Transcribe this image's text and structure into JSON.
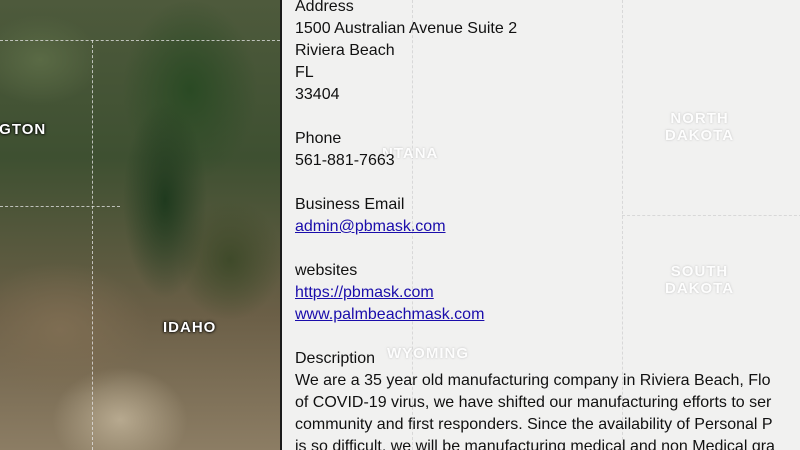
{
  "map": {
    "labels": {
      "washington_partial": "IGTON",
      "idaho": "IDAHO",
      "montana_partial": "NTANA",
      "north_dakota_line1": "NORTH",
      "north_dakota_line2": "DAKOTA",
      "south_dakota_line1": "SOUTH",
      "south_dakota_line2": "DAKOTA",
      "wyoming": "WYOMING"
    }
  },
  "listing": {
    "address": {
      "heading": "Address",
      "street": "1500 Australian Avenue Suite 2",
      "city": "Riviera Beach",
      "state": "FL",
      "zip": "33404"
    },
    "phone": {
      "heading": "Phone",
      "value": "561-881-7663"
    },
    "email": {
      "heading": "Business Email",
      "value": "admin@pbmask.com"
    },
    "websites": {
      "heading": "websites",
      "links": [
        "https://pbmask.com",
        "www.palmbeachmask.com"
      ]
    },
    "description": {
      "heading": "Description",
      "lines": [
        "We are a 35 year old manufacturing company in Riviera Beach, Flo",
        "of COVID-19 virus, we have shifted our manufacturing efforts to ser",
        "community and first responders. Since the availability of Personal P",
        "is so difficult, we will be manufacturing medical and non Medical gra"
      ]
    }
  }
}
